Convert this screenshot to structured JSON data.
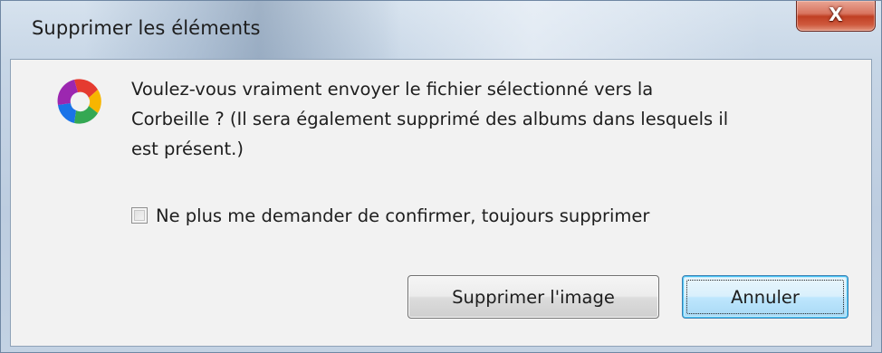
{
  "window": {
    "title": "Supprimer les éléments",
    "close_label": "X"
  },
  "icon": {
    "name": "picasa-logo-icon",
    "colors": [
      "#e53b30",
      "#f7b500",
      "#34a853",
      "#1a73e8",
      "#9c27b0"
    ]
  },
  "message": {
    "lines": [
      "Voulez-vous vraiment envoyer le fichier sélectionné vers la",
      "Corbeille ? (Il sera également supprimé des albums dans lesquels il",
      "est présent.)"
    ]
  },
  "checkbox": {
    "label": "Ne plus me demander de confirmer, toujours supprimer",
    "checked": false
  },
  "buttons": {
    "delete_label": "Supprimer l'image",
    "cancel_label": "Annuler"
  }
}
